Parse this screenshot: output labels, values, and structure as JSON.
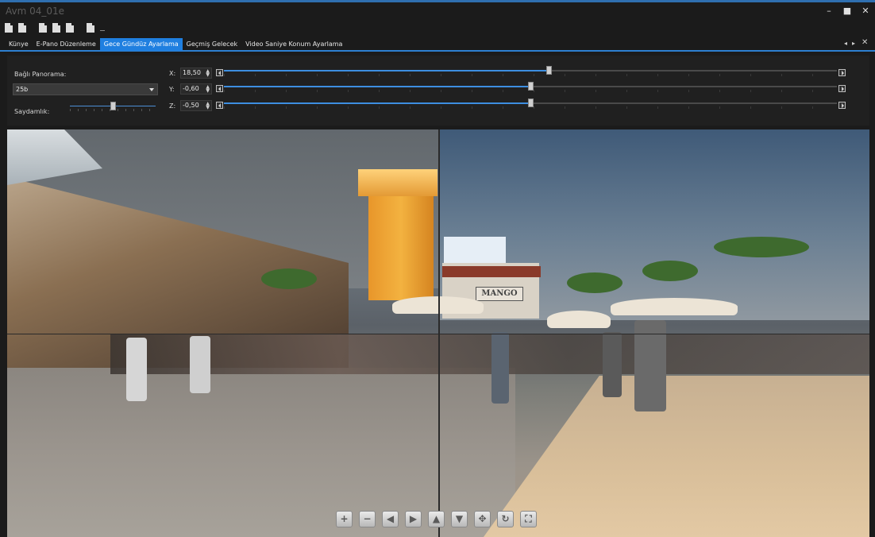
{
  "window": {
    "title": "Avm 04_01e",
    "min_label": "–",
    "max_label": "■",
    "close_label": "✕"
  },
  "toolbar": {
    "icons": [
      "document-icon",
      "document-icon",
      "document-icon",
      "document-icon",
      "document-icon",
      "document-icon"
    ]
  },
  "tabs": [
    {
      "label": "Künye",
      "active": false
    },
    {
      "label": "E-Pano Düzenleme",
      "active": false
    },
    {
      "label": "Gece Gündüz Ayarlama",
      "active": true
    },
    {
      "label": "Geçmiş Gelecek",
      "active": false
    },
    {
      "label": "Video Saniye Konum Ayarlama",
      "active": false
    }
  ],
  "tabnav": {
    "prev": "◂",
    "next": "▸",
    "close": "✕"
  },
  "panel": {
    "linked_panorama_label": "Bağlı Panorama:",
    "linked_panorama_value": "25b",
    "opacity_label": "Saydamlık:",
    "opacity_value": 0.5,
    "axes": [
      {
        "label": "X:",
        "value": "18,50",
        "level": 0.53
      },
      {
        "label": "Y:",
        "value": "-0,60",
        "level": 0.5
      },
      {
        "label": "Z:",
        "value": "-0,50",
        "level": 0.5
      }
    ]
  },
  "viewer": {
    "sign_text": "MANGO",
    "nav_buttons": [
      {
        "name": "zoom-in-icon",
        "glyph": "+"
      },
      {
        "name": "zoom-out-icon",
        "glyph": "−"
      },
      {
        "name": "arrow-left-icon",
        "glyph": "◀"
      },
      {
        "name": "arrow-right-icon",
        "glyph": "▶"
      },
      {
        "name": "arrow-up-icon",
        "glyph": "▲"
      },
      {
        "name": "arrow-down-icon",
        "glyph": "▼"
      },
      {
        "name": "move-icon",
        "glyph": "✥"
      },
      {
        "name": "rotate-icon",
        "glyph": "↻"
      },
      {
        "name": "fullscreen-icon",
        "glyph": "⛶"
      }
    ]
  },
  "colors": {
    "accent": "#1f7fe0",
    "background": "#1b1b1b",
    "panel": "#202020"
  }
}
